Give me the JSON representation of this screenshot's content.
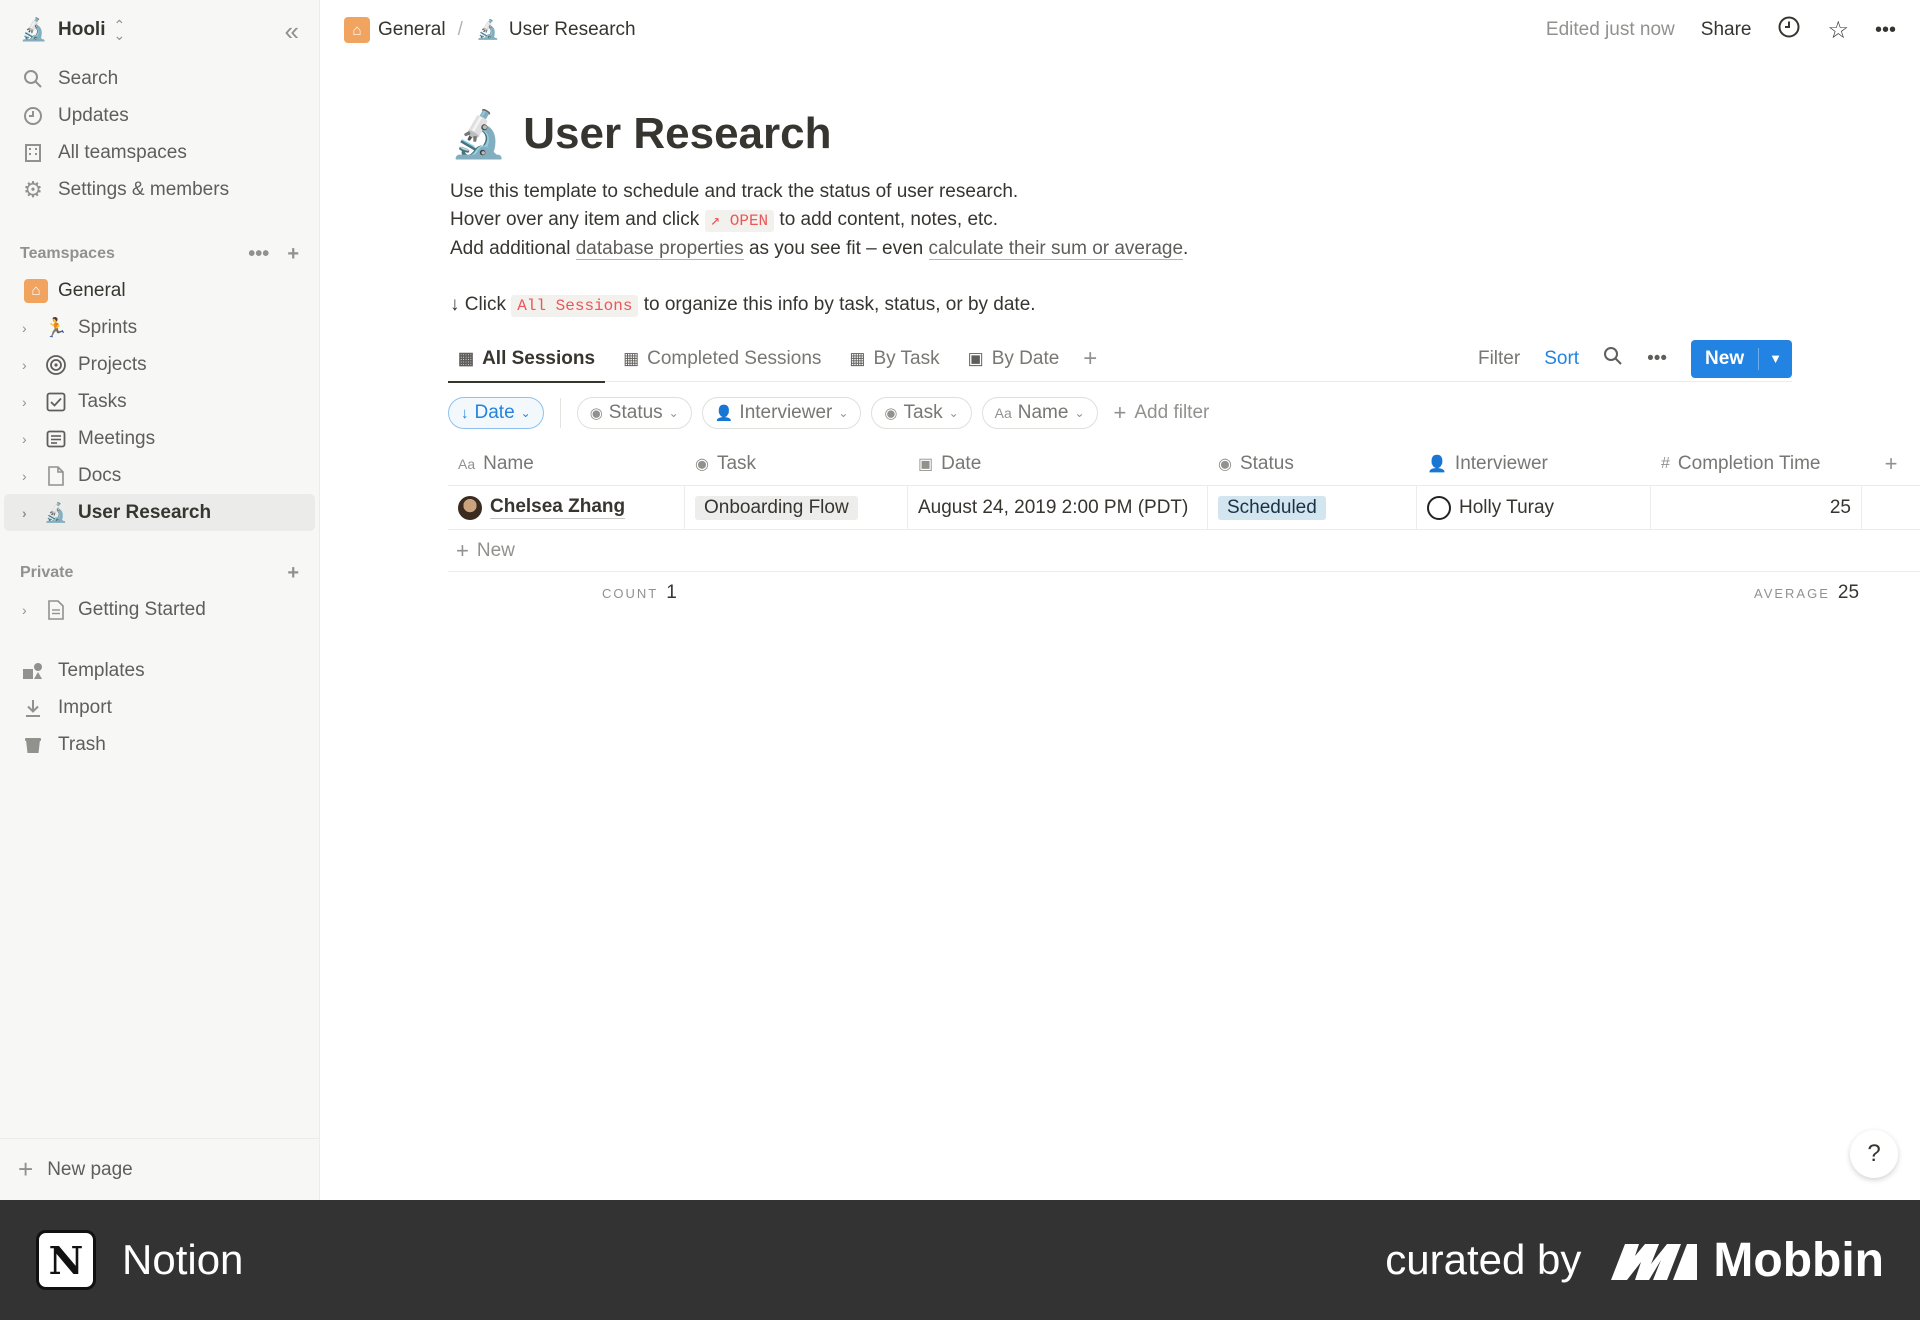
{
  "sidebar": {
    "workspace": {
      "name": "Hooli",
      "logo": "microscope-emoji"
    },
    "nav": [
      {
        "label": "Search",
        "icon": "search-icon"
      },
      {
        "label": "Updates",
        "icon": "clock-icon"
      },
      {
        "label": "All teamspaces",
        "icon": "building-icon"
      },
      {
        "label": "Settings & members",
        "icon": "gear-icon"
      }
    ],
    "teamspaces_label": "Teamspaces",
    "teamspaces": [
      {
        "label": "General",
        "icon": "house-icon"
      },
      {
        "label": "Sprints",
        "icon": "runner-icon"
      },
      {
        "label": "Projects",
        "icon": "target-icon"
      },
      {
        "label": "Tasks",
        "icon": "checkbox-icon"
      },
      {
        "label": "Meetings",
        "icon": "notes-icon"
      },
      {
        "label": "Docs",
        "icon": "document-icon"
      },
      {
        "label": "User Research",
        "icon": "microscope-icon"
      }
    ],
    "private_label": "Private",
    "private": [
      {
        "label": "Getting Started",
        "icon": "page-icon"
      }
    ],
    "bottom": [
      {
        "label": "Templates",
        "icon": "templates-icon"
      },
      {
        "label": "Import",
        "icon": "download-icon"
      },
      {
        "label": "Trash",
        "icon": "trash-icon"
      }
    ],
    "new_page": "New page"
  },
  "topbar": {
    "breadcrumb": [
      "General",
      "User Research"
    ],
    "edited": "Edited just now",
    "share": "Share"
  },
  "page": {
    "title": "User Research",
    "line1": "Use this template to schedule and track the status of user research.",
    "line2_a": "Hover over any item and click",
    "line2_code": "↗ OPEN",
    "line2_b": "to add content, notes, etc.",
    "line3_a": "Add additional",
    "line3_link1": "database properties",
    "line3_b": "as you see fit – even",
    "line3_link2": "calculate their sum or average",
    "line3_c": ".",
    "line4_a": "↓ Click",
    "line4_code": "All Sessions",
    "line4_b": "to organize this info by task, status, or by date."
  },
  "views": {
    "tabs": [
      "All Sessions",
      "Completed Sessions",
      "By Task",
      "By Date"
    ],
    "filter": "Filter",
    "sort": "Sort",
    "new": "New"
  },
  "filters": {
    "sort_chip": "Date",
    "chips": [
      "Status",
      "Interviewer",
      "Task",
      "Name"
    ],
    "add_filter": "Add filter"
  },
  "table": {
    "columns": [
      "Name",
      "Task",
      "Date",
      "Status",
      "Interviewer",
      "Completion Time"
    ],
    "rows": [
      {
        "name": "Chelsea Zhang",
        "task": "Onboarding Flow",
        "date": "August 24, 2019 2:00 PM (PDT)",
        "status": "Scheduled",
        "interviewer": "Holly Turay",
        "completion": "25"
      }
    ],
    "new_row": "New",
    "count_label": "COUNT",
    "count_value": "1",
    "average_label": "AVERAGE",
    "average_value": "25"
  },
  "help": "?",
  "footer": {
    "app": "Notion",
    "curated": "curated by",
    "brand": "Mobbin"
  },
  "colors": {
    "accent": "#2383e2",
    "status_scheduled": "#d3e5ef",
    "footer_bg": "#333333"
  }
}
